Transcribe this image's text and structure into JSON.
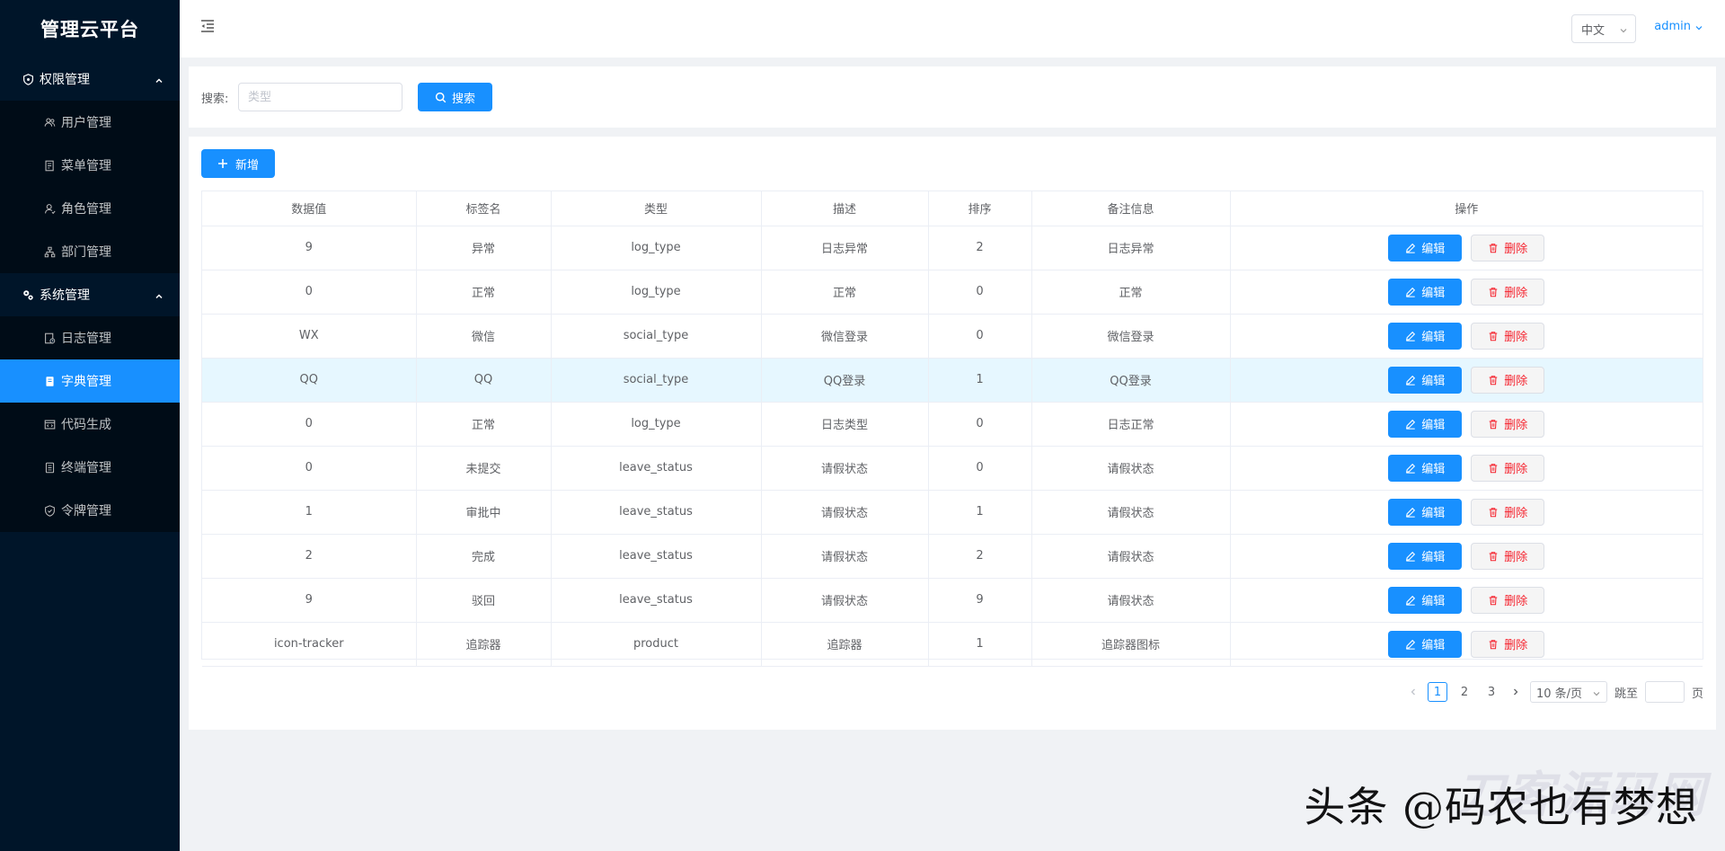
{
  "sidebar": {
    "logo": "管理云平台",
    "groups": [
      {
        "title": "权限管理",
        "icon": "shield-icon",
        "items": [
          {
            "label": "用户管理",
            "icon": "users-icon"
          },
          {
            "label": "菜单管理",
            "icon": "menu-doc-icon"
          },
          {
            "label": "角色管理",
            "icon": "role-icon"
          },
          {
            "label": "部门管理",
            "icon": "org-icon"
          }
        ]
      },
      {
        "title": "系统管理",
        "icon": "gears-icon",
        "items": [
          {
            "label": "日志管理",
            "icon": "log-icon"
          },
          {
            "label": "字典管理",
            "icon": "dict-icon"
          },
          {
            "label": "代码生成",
            "icon": "code-icon"
          },
          {
            "label": "终端管理",
            "icon": "terminal-icon"
          },
          {
            "label": "令牌管理",
            "icon": "token-icon"
          }
        ]
      }
    ],
    "active_item": "字典管理"
  },
  "header": {
    "language": "中文",
    "user": "admin"
  },
  "search": {
    "label": "搜索:",
    "placeholder": "类型",
    "button": "搜索"
  },
  "toolbar": {
    "add_label": "新增"
  },
  "table": {
    "columns": [
      "数据值",
      "标签名",
      "类型",
      "描述",
      "排序",
      "备注信息",
      "操作"
    ],
    "edit_label": "编辑",
    "delete_label": "删除",
    "rows": [
      [
        "9",
        "异常",
        "log_type",
        "日志异常",
        "2",
        "日志异常"
      ],
      [
        "0",
        "正常",
        "log_type",
        "正常",
        "0",
        "正常"
      ],
      [
        "WX",
        "微信",
        "social_type",
        "微信登录",
        "0",
        "微信登录"
      ],
      [
        "QQ",
        "QQ",
        "social_type",
        "QQ登录",
        "1",
        "QQ登录"
      ],
      [
        "0",
        "正常",
        "log_type",
        "日志类型",
        "0",
        "日志正常"
      ],
      [
        "0",
        "未提交",
        "leave_status",
        "请假状态",
        "0",
        "请假状态"
      ],
      [
        "1",
        "审批中",
        "leave_status",
        "请假状态",
        "1",
        "请假状态"
      ],
      [
        "2",
        "完成",
        "leave_status",
        "请假状态",
        "2",
        "请假状态"
      ],
      [
        "9",
        "驳回",
        "leave_status",
        "请假状态",
        "9",
        "请假状态"
      ],
      [
        "icon-tracker",
        "追踪器",
        "product",
        "追踪器",
        "1",
        "追踪器图标"
      ]
    ],
    "highlighted_row": 3
  },
  "pagination": {
    "pages": [
      "1",
      "2",
      "3"
    ],
    "current": "1",
    "page_size": "10 条/页",
    "jump_label": "跳至",
    "page_suffix": "页"
  },
  "watermark": {
    "text": "头条 @码农也有梦想",
    "bg_text": "刀客源码网"
  },
  "colors": {
    "primary": "#1890ff",
    "sidebar_bg": "#001529",
    "submenu_bg": "#000c17",
    "danger": "#f5222d",
    "row_highlight": "#e6f7ff"
  }
}
